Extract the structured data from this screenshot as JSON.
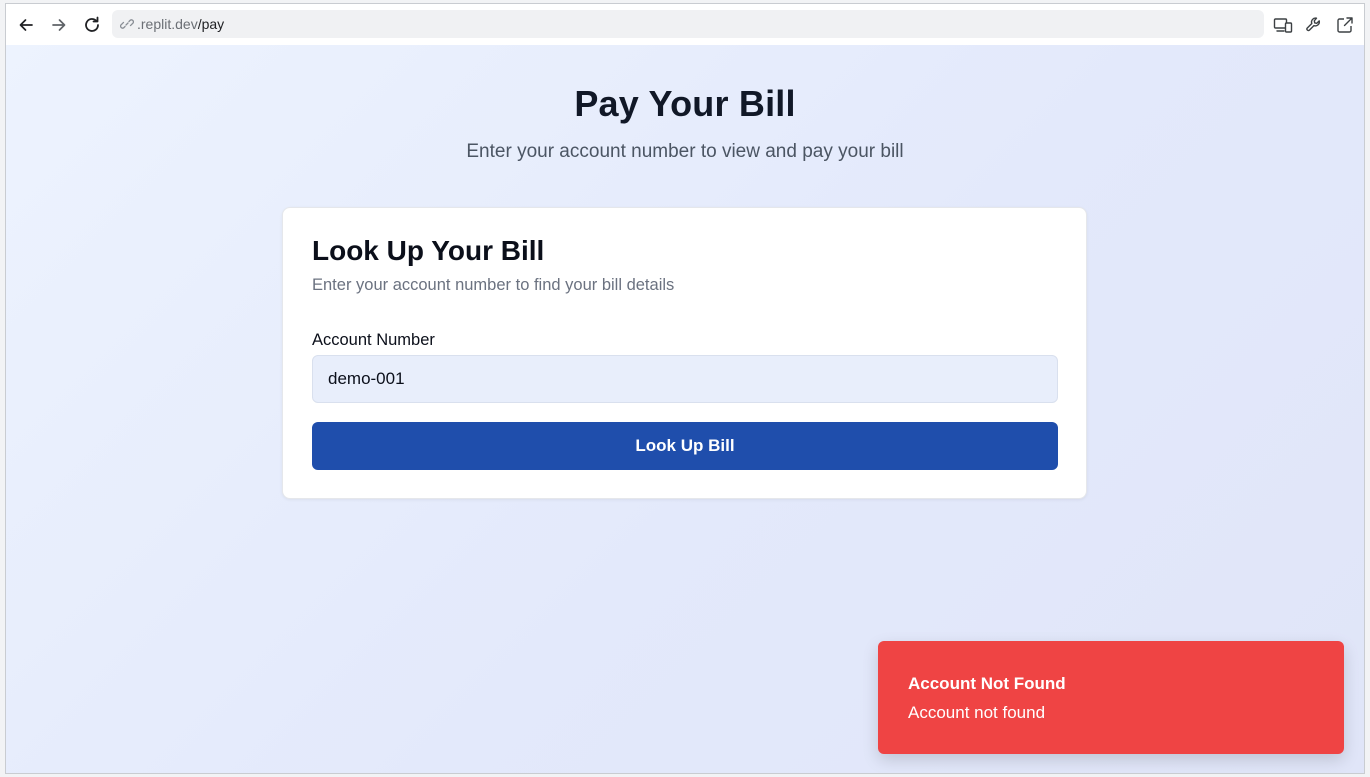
{
  "browser": {
    "url_host": ".replit.dev",
    "url_path": "/pay",
    "icons": [
      "back-arrow-icon",
      "forward-arrow-icon",
      "reload-icon",
      "link-icon",
      "devices-icon",
      "wrench-icon",
      "open-external-icon"
    ]
  },
  "header": {
    "title": "Pay Your Bill",
    "subtitle": "Enter your account number to view and pay your bill"
  },
  "card": {
    "title": "Look Up Your Bill",
    "description": "Enter your account number to find your bill details",
    "account_label": "Account Number",
    "account_value": "demo-001",
    "submit_label": "Look Up Bill"
  },
  "toast": {
    "title": "Account Not Found",
    "message": "Account not found"
  },
  "colors": {
    "primary": "#1f4eac",
    "toast_error": "#ef4444",
    "input_bg": "#e8eefb"
  }
}
